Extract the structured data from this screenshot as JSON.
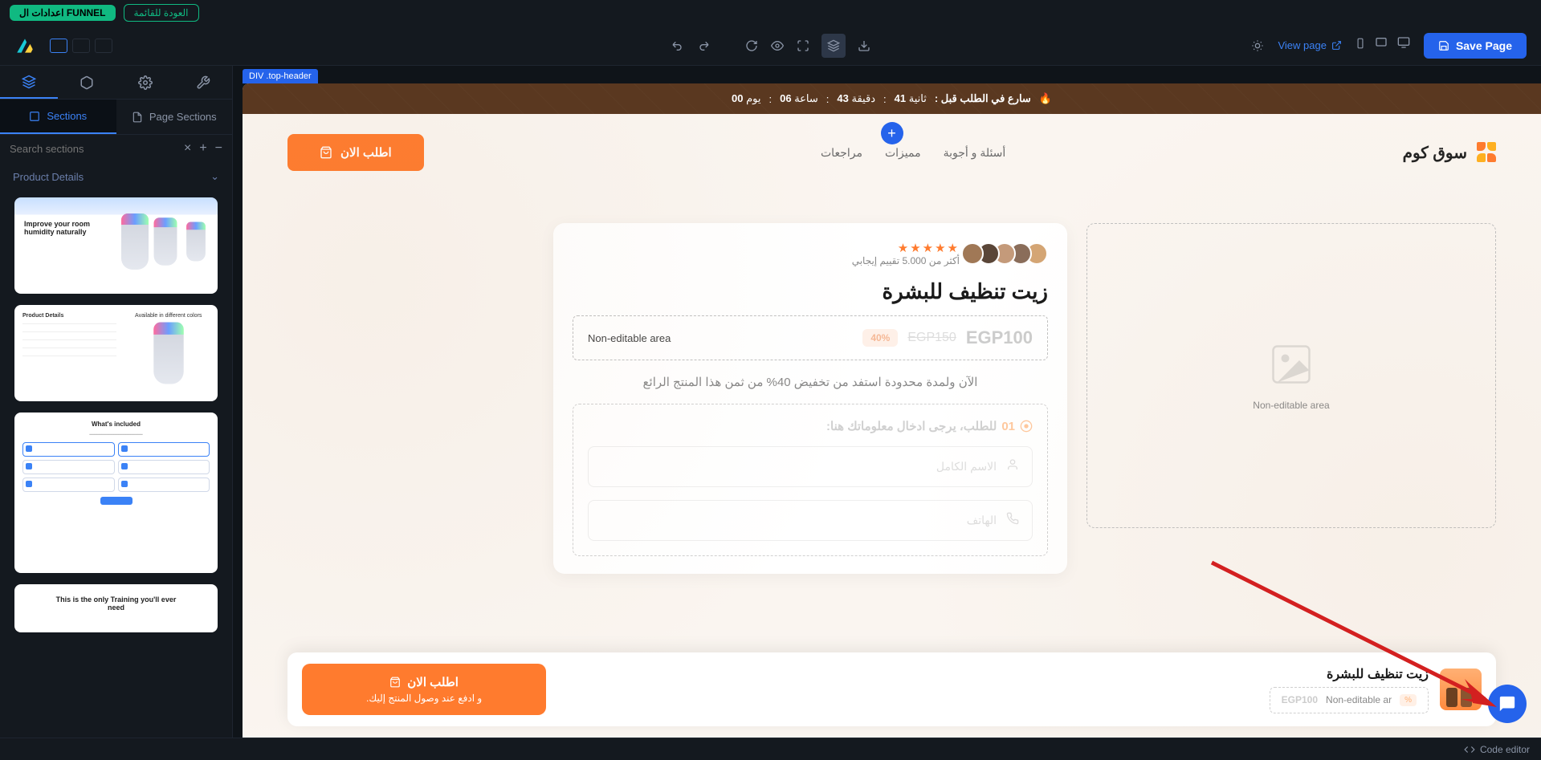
{
  "topbar": {
    "funnel_btn": "اعدادات ال FUNNEL",
    "back_btn": "العودة للقائمة"
  },
  "header": {
    "view_page": "View page",
    "save": "Save Page"
  },
  "sidebar": {
    "tabs": {
      "sections": "Sections",
      "page_sections": "Page Sections"
    },
    "search_placeholder": "Search sections",
    "accordion": "Product Details",
    "thumb1_line1": "Improve your room",
    "thumb1_line2": "humidity naturally",
    "thumb2_left": "Product Details",
    "thumb2_right": "Available in different colors",
    "thumb3_title": "What's included",
    "thumb4_line1": "This is the only Training you'll ever",
    "thumb4_line2": "need"
  },
  "canvas": {
    "selected": "DIV .top-header",
    "promo": {
      "prefix": "سارع في الطلب قبل :",
      "day_val": "00",
      "day_lbl": "يوم",
      "hr_val": "06",
      "hr_lbl": "ساعة",
      "min_val": "43",
      "min_lbl": "دقيقة",
      "sec_val": "41",
      "sec_lbl": "ثانية"
    },
    "brand": "سوق كوم",
    "nav": {
      "l1": "أسئلة و أجوبة",
      "l2": "مميزات",
      "l3": "مراجعات"
    },
    "order_btn": "اطلب الان",
    "non_editable": "Non-editable area",
    "rating_text": "أكثر من 5.000 تقييم إيجابي",
    "product_title": "زيت تنظيف للبشرة",
    "price_main": "EGP100",
    "price_old": "EGP150",
    "price_badge": "40%",
    "promo_text": "الآن ولمدة محدودة استفد من تخفيض 40% من ثمن هذا المنتج الرائع",
    "form_num": "01",
    "form_title": "للطلب، يرجى ادخال معلوماتك هنا:",
    "ph_name": "الاسم الكامل",
    "ph_phone": "الهاتف",
    "sticky_title": "زيت تنظيف للبشرة",
    "sticky_price": "EGP100",
    "sticky_non_edit_short": "Non-editable ar",
    "sticky_order": "اطلب الان",
    "sticky_sub": "و ادفع عند وصول المنتج إليك."
  },
  "status": {
    "code_editor": "Code editor"
  }
}
